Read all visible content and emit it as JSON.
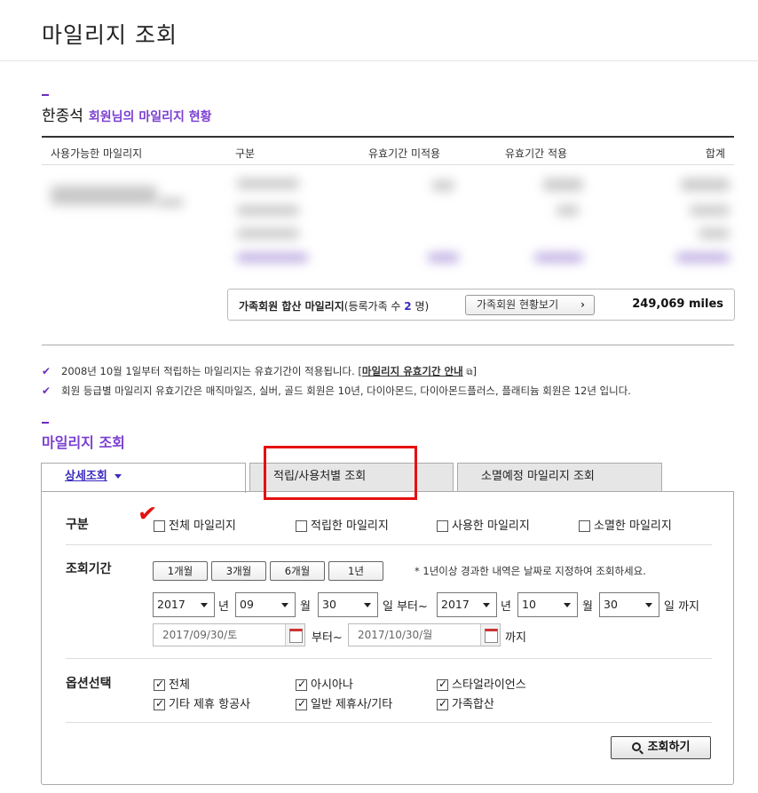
{
  "page": {
    "title": "마일리지 조회"
  },
  "member": {
    "name": "한종석",
    "subtitle": "회원님의 마일리지 현황"
  },
  "summary": {
    "columns": [
      "사용가능한 마일리지",
      "구분",
      "유효기간 미적용",
      "유효기간 적용",
      "합계"
    ]
  },
  "family": {
    "label": "가족회원 합산 마일리지",
    "count_prefix": "(등록가족 수 ",
    "count": "2",
    "count_suffix": " 명)",
    "button": "가족회원 현황보기",
    "total": "249,069 miles"
  },
  "notes": {
    "n1_text": "2008년 10월 1일부터 적립하는 마일리지는 유효기간이 적용됩니다. [",
    "n1_link": "마일리지 유효기간 안내",
    "n1_end": "]",
    "n2_text": "회원 등급별 마일리지 유효기간은 매직마일즈, 실버, 골드 회원은 10년, 다이아몬드, 다이아몬드플러스, 플래티늄 회원은 12년 입니다."
  },
  "section": {
    "title": "마일리지 조회"
  },
  "tabs": [
    {
      "label": "상세조회"
    },
    {
      "label": "적립/사용처별 조회"
    },
    {
      "label": "소멸예정 마일리지 조회"
    }
  ],
  "filter": {
    "type_label": "구분",
    "types": [
      "전체 마일리지",
      "적립한 마일리지",
      "사용한 마일리지",
      "소멸한 마일리지"
    ],
    "period_label": "조회기간",
    "period_buttons": [
      "1개월",
      "3개월",
      "6개월",
      "1년"
    ],
    "period_note": "* 1년이상 경과한 내역은 날짜로 지정하여 조회하세요.",
    "from": {
      "year": "2017",
      "month": "09",
      "day": "30"
    },
    "to": {
      "year": "2017",
      "month": "10",
      "day": "30"
    },
    "units": {
      "year": "년",
      "month": "월",
      "from_day": "일 부터~",
      "to_day": "일 까지"
    },
    "date_from": "2017/09/30/토",
    "date_from_suffix": "부터~",
    "date_to": "2017/10/30/월",
    "date_to_suffix": "까지",
    "options_label": "옵션선택",
    "options": [
      "전체",
      "아시아나",
      "스타얼라이언스",
      "기타 제휴 항공사",
      "일반 제휴사/기타",
      "가족합산"
    ],
    "search_button": "조회하기"
  }
}
